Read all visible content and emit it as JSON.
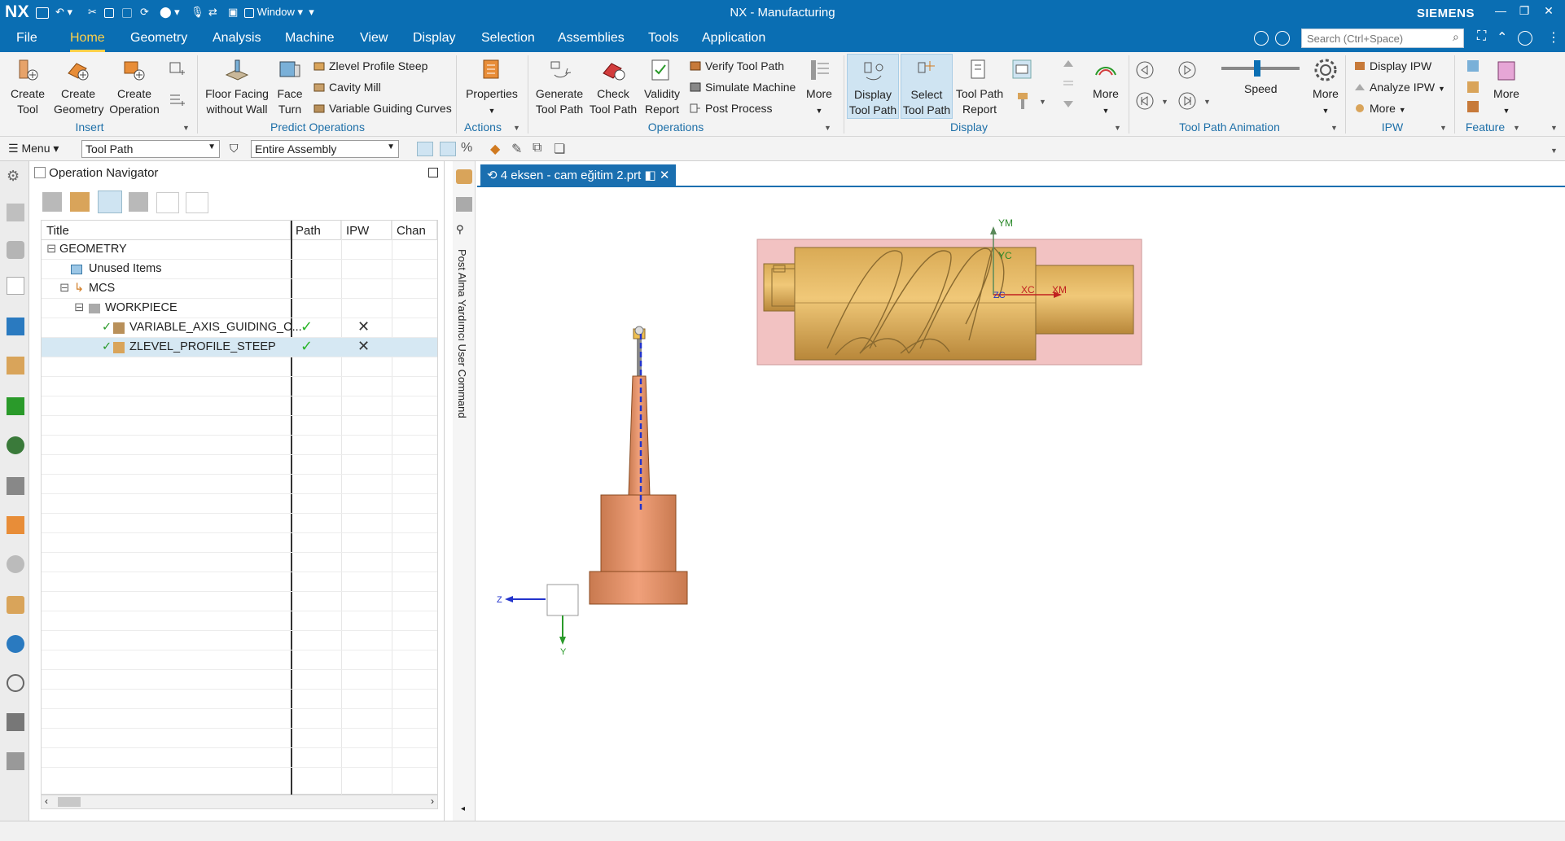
{
  "app": {
    "logo": "NX",
    "title": "NX - Manufacturing",
    "brand": "SIEMENS",
    "window_menu": "Window"
  },
  "menu": {
    "tabs": [
      "File",
      "Home",
      "Geometry",
      "Analysis",
      "Machine",
      "View",
      "Display",
      "Selection",
      "Assemblies",
      "Tools",
      "Application"
    ],
    "active": "Home",
    "search_placeholder": "Search (Ctrl+Space)"
  },
  "ribbon": {
    "insert": {
      "create_tool": [
        "Create",
        "Tool"
      ],
      "create_geometry": [
        "Create",
        "Geometry"
      ],
      "create_operation": [
        "Create",
        "Operation"
      ],
      "group": "Insert"
    },
    "predict": {
      "floor_facing": [
        "Floor Facing",
        "without Wall"
      ],
      "face_turn": [
        "Face",
        "Turn"
      ],
      "items": [
        "Zlevel Profile Steep",
        "Cavity Mill",
        "Variable Guiding Curves"
      ],
      "group": "Predict Operations"
    },
    "actions": {
      "properties": "Properties",
      "group": "Actions"
    },
    "operations": {
      "generate": [
        "Generate",
        "Tool Path"
      ],
      "check": [
        "Check",
        "Tool Path"
      ],
      "validity": [
        "Validity",
        "Report"
      ],
      "items": [
        "Verify Tool Path",
        "Simulate Machine",
        "Post Process"
      ],
      "more": "More",
      "group": "Operations"
    },
    "display": {
      "display_tp": [
        "Display",
        "Tool Path"
      ],
      "select_tp": [
        "Select",
        "Tool Path"
      ],
      "report": [
        "Tool Path",
        "Report"
      ],
      "more": "More",
      "group": "Display"
    },
    "animation": {
      "speed": "Speed",
      "more": "More",
      "group": "Tool Path Animation"
    },
    "ipw": {
      "items": [
        "Display IPW",
        "Analyze IPW",
        "More"
      ],
      "group": "IPW"
    },
    "feature": {
      "more": "More",
      "group": "Feature"
    }
  },
  "selbar": {
    "menu": "Menu",
    "filter": "Tool Path",
    "scope": "Entire Assembly"
  },
  "navigator": {
    "title": "Operation Navigator",
    "columns": [
      "Title",
      "Path",
      "IPW",
      "Chan"
    ],
    "rows": [
      {
        "title": "GEOMETRY",
        "path": "",
        "ipw": ""
      },
      {
        "title": "Unused Items",
        "path": "",
        "ipw": ""
      },
      {
        "title": "MCS",
        "path": "",
        "ipw": ""
      },
      {
        "title": "WORKPIECE",
        "path": "",
        "ipw": ""
      },
      {
        "title": "VARIABLE_AXIS_GUIDING_C...",
        "path": "ok",
        "ipw": "none"
      },
      {
        "title": "ZLEVEL_PROFILE_STEEP",
        "path": "ok",
        "ipw": "none"
      }
    ]
  },
  "sidestrip": {
    "text": "Post Alma Yardımcı  User Command"
  },
  "viewport": {
    "tab": "4 eksen - cam eğitim 2.prt",
    "axes": {
      "ym": "YM",
      "yc": "YC",
      "zc": "ZC",
      "xc": "XC",
      "xm": "XM",
      "z": "Z",
      "y": "Y"
    }
  }
}
